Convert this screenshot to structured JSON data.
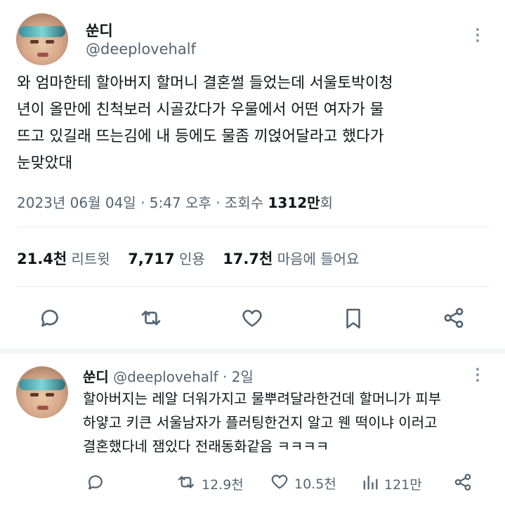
{
  "tweet": {
    "author_name": "쑨디",
    "author_handle": "@deeplovehalf",
    "text": "와 엄마한테 할아버지 할머니 결혼썰 들었는데 서울토박이청\n년이 올만에 친척보러 시골갔다가 우물에서 어떤 여자가 물\n뜨고 있길래 뜨는김에 내 등에도 물좀 끼얹어달라고 했다가\n눈맞았대",
    "date": "2023년 06월 04일 · 5:47 오후 · 조회수 ",
    "views": "1312만",
    "views_suffix": "회",
    "stats": {
      "retweets_value": "21.4천",
      "retweets_label": "리트윗",
      "quotes_value": "7,717",
      "quotes_label": "인용",
      "likes_value": "17.7천",
      "likes_label": "마음에 들어요"
    }
  },
  "reply": {
    "author_name": "쑨디",
    "author_handle": "@deeplovehalf",
    "time": "· 2일",
    "text": "할아버지는 레알 더워가지고 물뿌려달라한건데 할머니가 피부\n하얗고 키큰 서울남자가 플러팅한건지 알고 웬 떡이냐 이러고\n결혼했다네 잼있다 전래동화같음 ㅋㅋㅋㅋ",
    "retweets": "12.9천",
    "likes": "10.5천",
    "views": "121만"
  }
}
